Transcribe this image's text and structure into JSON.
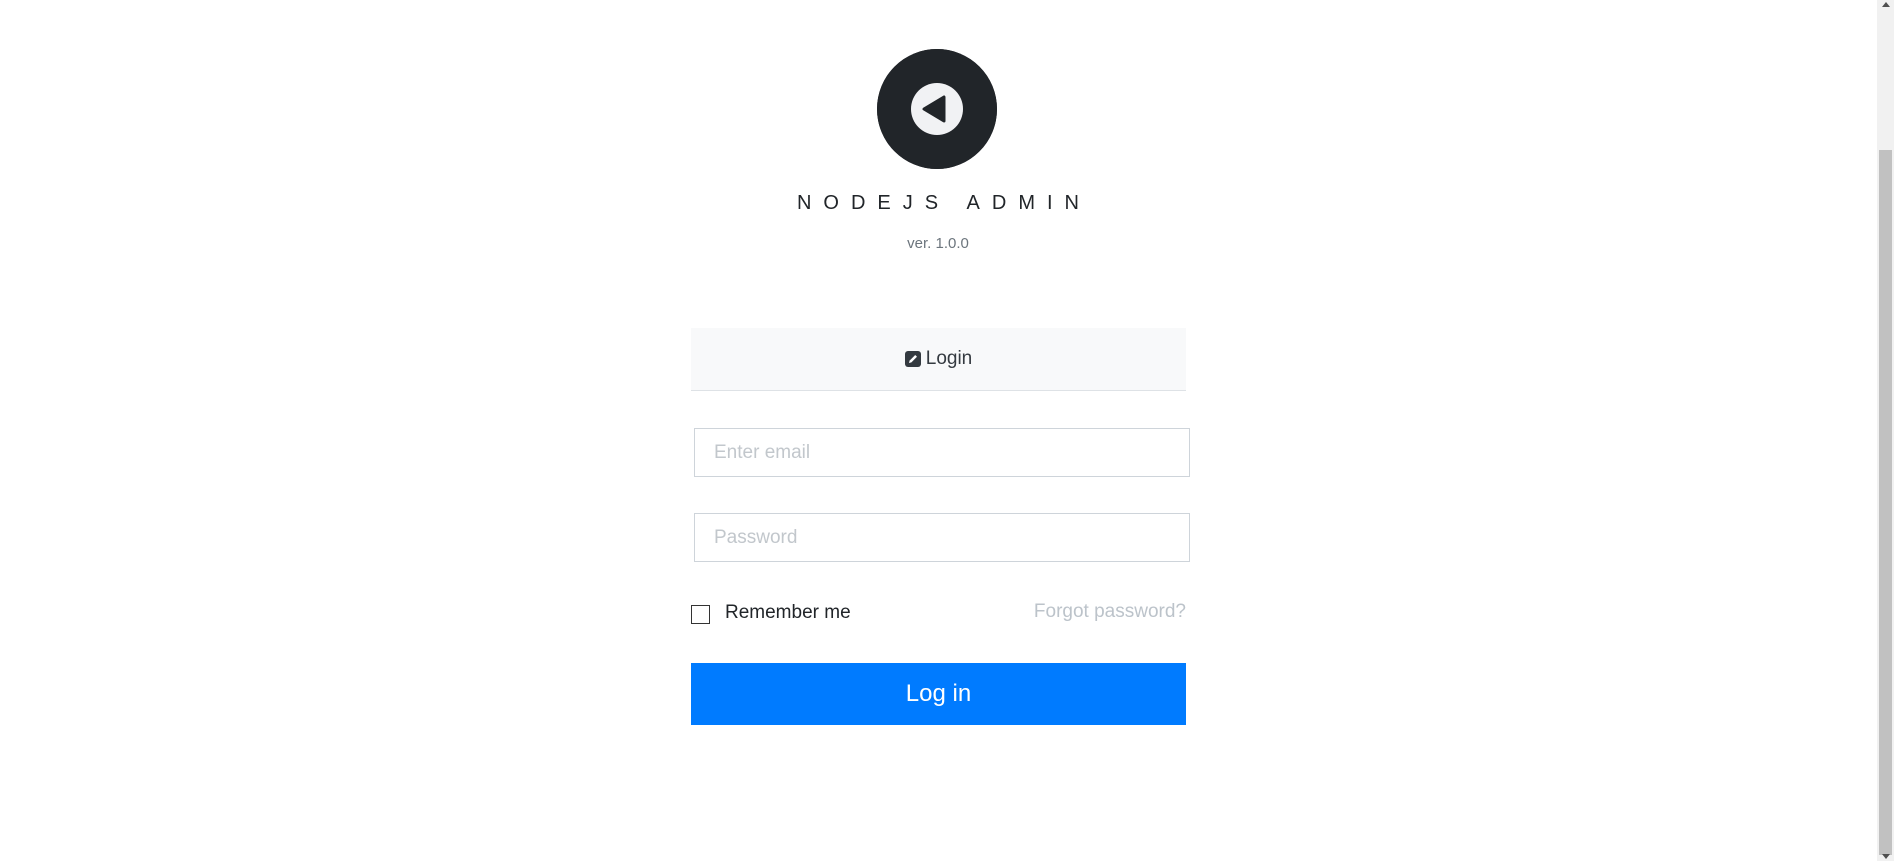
{
  "app": {
    "title": "NODEJS ADMIN",
    "version": "ver. 1.0.0",
    "logo_icon": "play-back-circle-icon"
  },
  "login_card": {
    "header_icon": "edit-icon",
    "header_label": "Login"
  },
  "form": {
    "email_placeholder": "Enter email",
    "email_value": "",
    "password_placeholder": "Password",
    "password_value": "",
    "remember_label": "Remember me",
    "remember_checked": false,
    "forgot_label": "Forgot password?",
    "submit_label": "Log in"
  },
  "colors": {
    "primary": "#007bff",
    "logo_bg": "#212529",
    "header_bg": "#f8f9fa",
    "muted_link": "#bcc3ca"
  }
}
